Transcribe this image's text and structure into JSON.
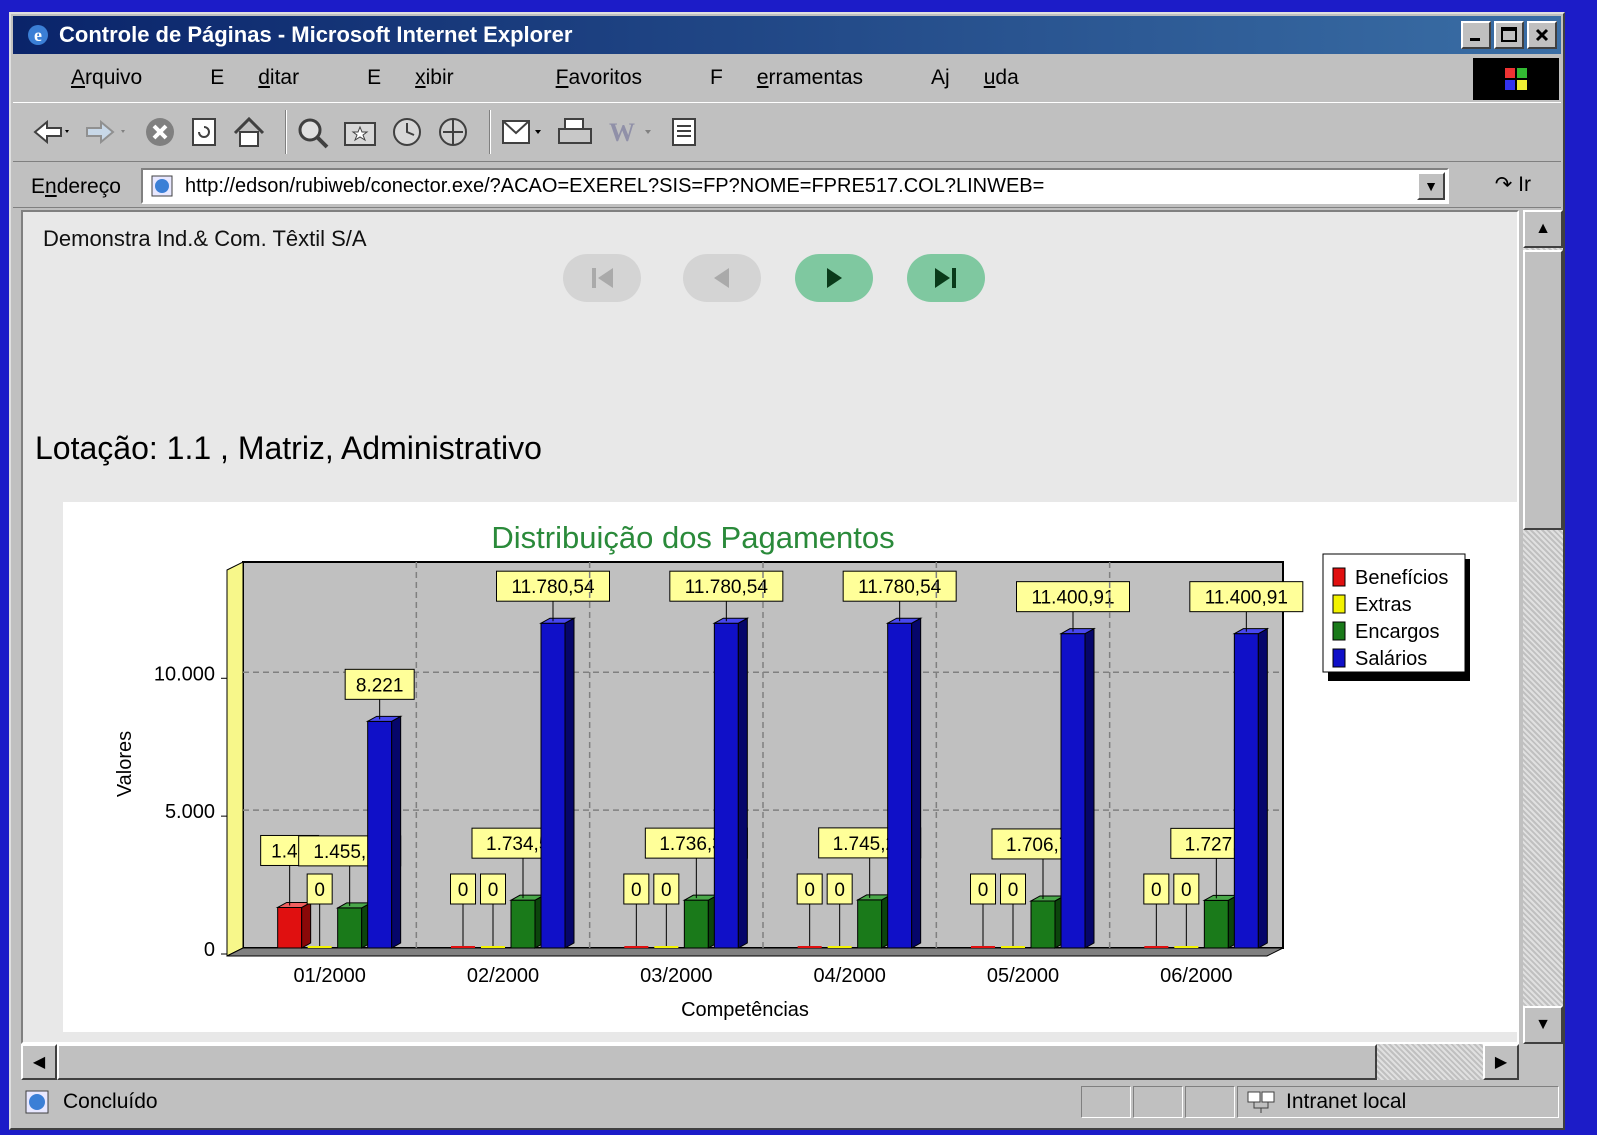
{
  "window": {
    "title": "Controle de Páginas - Microsoft Internet Explorer"
  },
  "menu": {
    "items": [
      {
        "pre": "",
        "key": "A",
        "post": "rquivo"
      },
      {
        "pre": "E",
        "key": "d",
        "post": "itar"
      },
      {
        "pre": "E",
        "key": "x",
        "post": "ibir"
      },
      {
        "pre": "",
        "key": "F",
        "post": "avoritos"
      },
      {
        "pre": "F",
        "key": "e",
        "post": "rramentas"
      },
      {
        "pre": "Aj",
        "key": "u",
        "post": "da"
      }
    ]
  },
  "address": {
    "label_pre": "E",
    "label_key": "n",
    "label_post": "dereço",
    "url": "http://edson/rubiweb/conector.exe/?ACAO=EXEREL?SIS=FP?NOME=FPRE517.COL?LINWEB=",
    "go": "Ir"
  },
  "page": {
    "company": "Demonstra Ind.& Com. Têxtil S/A",
    "lotacao": "Lotação:  1.1 , Matriz, Administrativo"
  },
  "status": {
    "text": "Concluído",
    "zone": "Intranet local"
  },
  "colors": {
    "beneficios": "#e01010",
    "extras": "#f2f200",
    "encargos": "#1a7a1a",
    "salarios": "#1010c8"
  },
  "chart_data": {
    "type": "bar",
    "title": "Distribuição dos Pagamentos",
    "xlabel": "Competências",
    "ylabel": "Valores",
    "ylim": [
      0,
      14000
    ],
    "yticks": [
      0,
      5000,
      10000
    ],
    "ytick_labels": [
      "0",
      "5.000",
      "10.000"
    ],
    "grid": true,
    "legend_position": "right",
    "categories": [
      "01/2000",
      "02/2000",
      "03/2000",
      "04/2000",
      "05/2000",
      "06/2000"
    ],
    "series": [
      {
        "name": "Benefícios",
        "color": "#e01010",
        "values": [
          1470,
          0,
          0,
          0,
          0,
          0
        ],
        "labels": [
          "1.47",
          "0",
          "0",
          "0",
          "0",
          "0"
        ]
      },
      {
        "name": "Extras",
        "color": "#f2f200",
        "values": [
          0,
          0,
          0,
          0,
          0,
          0
        ],
        "labels": [
          "0",
          "0",
          "0",
          "0",
          "0",
          "0"
        ]
      },
      {
        "name": "Encargos",
        "color": "#1a7a1a",
        "values": [
          1455.11,
          1734.56,
          1736.37,
          1745.23,
          1706.77,
          1727.7
        ],
        "labels": [
          "1.455,11",
          "1.734,56",
          "1.736,37",
          "1.745,23",
          "1.706,77",
          "1.727,7"
        ]
      },
      {
        "name": "Salários",
        "color": "#1010c8",
        "values": [
          8221,
          11780.54,
          11780.54,
          11780.54,
          11400.91,
          11400.91
        ],
        "labels": [
          "8.221",
          "11.780,54",
          "11.780,54",
          "11.780,54",
          "11.400,91",
          "11.400,91"
        ]
      }
    ]
  }
}
